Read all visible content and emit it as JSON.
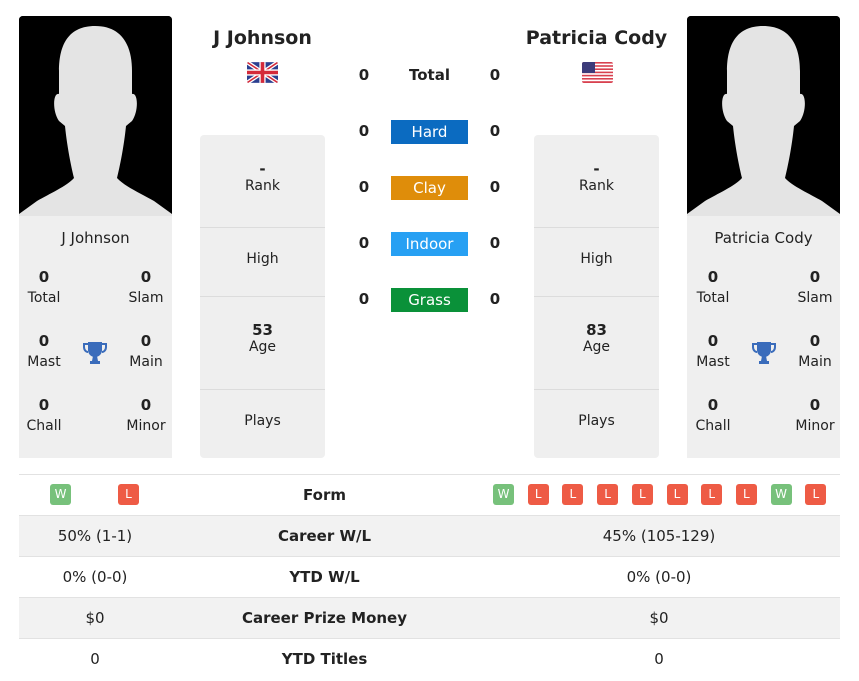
{
  "colors": {
    "hard": "#0b6bc1",
    "clay": "#df8d0a",
    "indoor": "#27a0f3",
    "grass": "#0a9139",
    "win": "#77c17b",
    "loss": "#ee5b45",
    "trophy": "#3a6cbb"
  },
  "player1": {
    "name": "J Johnson",
    "flag_icon": "uk-flag-icon",
    "card_name": "J Johnson",
    "titles": {
      "total": {
        "value": "0",
        "label": "Total"
      },
      "slam": {
        "value": "0",
        "label": "Slam"
      },
      "mast": {
        "value": "0",
        "label": "Mast"
      },
      "main": {
        "value": "0",
        "label": "Main"
      },
      "chall": {
        "value": "0",
        "label": "Chall"
      },
      "minor": {
        "value": "0",
        "label": "Minor"
      }
    },
    "info": {
      "rank": {
        "value": "-",
        "label": "Rank"
      },
      "high": {
        "value": "",
        "label": "High"
      },
      "age": {
        "value": "53",
        "label": "Age"
      },
      "plays": {
        "value": "",
        "label": "Plays"
      }
    },
    "form": [
      "W",
      "L"
    ],
    "career_wl": "50% (1-1)",
    "ytd_wl": "0% (0-0)",
    "career_prize": "$0",
    "ytd_titles": "0"
  },
  "player2": {
    "name": "Patricia Cody",
    "flag_icon": "us-flag-icon",
    "card_name": "Patricia Cody",
    "titles": {
      "total": {
        "value": "0",
        "label": "Total"
      },
      "slam": {
        "value": "0",
        "label": "Slam"
      },
      "mast": {
        "value": "0",
        "label": "Mast"
      },
      "main": {
        "value": "0",
        "label": "Main"
      },
      "chall": {
        "value": "0",
        "label": "Chall"
      },
      "minor": {
        "value": "0",
        "label": "Minor"
      }
    },
    "info": {
      "rank": {
        "value": "-",
        "label": "Rank"
      },
      "high": {
        "value": "",
        "label": "High"
      },
      "age": {
        "value": "83",
        "label": "Age"
      },
      "plays": {
        "value": "",
        "label": "Plays"
      }
    },
    "form": [
      "W",
      "L",
      "L",
      "L",
      "L",
      "L",
      "L",
      "L",
      "W",
      "L"
    ],
    "career_wl": "45% (105-129)",
    "ytd_wl": "0% (0-0)",
    "career_prize": "$0",
    "ytd_titles": "0"
  },
  "h2h": {
    "total": {
      "label": "Total",
      "p1": "0",
      "p2": "0"
    },
    "surfaces": [
      {
        "key": "hard",
        "label": "Hard",
        "p1": "0",
        "p2": "0"
      },
      {
        "key": "clay",
        "label": "Clay",
        "p1": "0",
        "p2": "0"
      },
      {
        "key": "indoor",
        "label": "Indoor",
        "p1": "0",
        "p2": "0"
      },
      {
        "key": "grass",
        "label": "Grass",
        "p1": "0",
        "p2": "0"
      }
    ]
  },
  "comparison": {
    "form_label": "Form",
    "career_wl_label": "Career W/L",
    "ytd_wl_label": "YTD W/L",
    "career_prize_label": "Career Prize Money",
    "ytd_titles_label": "YTD Titles"
  }
}
